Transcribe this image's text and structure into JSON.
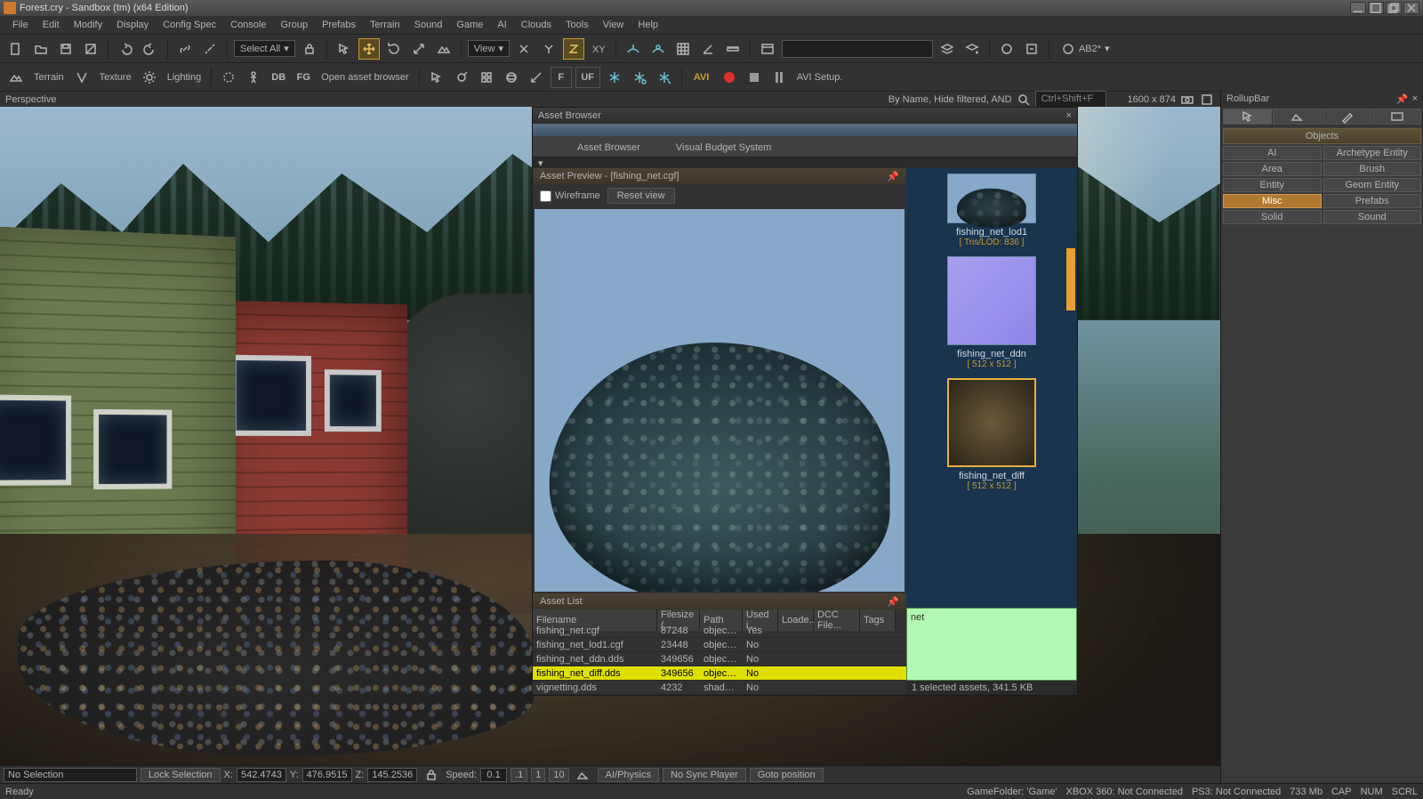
{
  "window": {
    "title": "Forest.cry - Sandbox (tm) (x64 Edition)"
  },
  "menu": [
    "File",
    "Edit",
    "Modify",
    "Display",
    "Config Spec",
    "Console",
    "Group",
    "Prefabs",
    "Terrain",
    "Sound",
    "Game",
    "AI",
    "Clouds",
    "Tools",
    "View",
    "Help"
  ],
  "toolbar1": {
    "select_all": "Select All",
    "view": "View",
    "ab2": "AB2*"
  },
  "toolbar2": {
    "terrain": "Terrain",
    "texture": "Texture",
    "lighting": "Lighting",
    "db": "DB",
    "fg": "FG",
    "open_asset_browser": "Open asset browser",
    "f": "F",
    "uf": "UF",
    "avi": "AVI",
    "avi_setup": "AVI Setup."
  },
  "viewport": {
    "label": "Perspective",
    "search_label": "By Name, Hide filtered, AND",
    "search_hint": "Ctrl+Shift+F",
    "resolution": "1600 x 874"
  },
  "asset_browser": {
    "title": "Asset Browser",
    "tabs": [
      "Asset Browser",
      "Visual Budget System"
    ],
    "preview_title_prefix": "Asset Preview - [",
    "preview_file": "fishing_net.cgf",
    "preview_title_suffix": "]",
    "wireframe": "Wireframe",
    "reset_view": "Reset view",
    "asset_list": "Asset List",
    "columns": [
      "Filename",
      "Filesize (...",
      "Path",
      "Used i...",
      "Loade...",
      "DCC File...",
      "Tags"
    ],
    "rows": [
      {
        "name": "fishing_net.cgf",
        "size": "87248",
        "path": "objects/...",
        "used": "Yes",
        "l": "",
        "dcc": "",
        "tags": ""
      },
      {
        "name": "fishing_net_lod1.cgf",
        "size": "23448",
        "path": "objects/...",
        "used": "No",
        "l": "",
        "dcc": "",
        "tags": ""
      },
      {
        "name": "fishing_net_ddn.dds",
        "size": "349656",
        "path": "objects/...",
        "used": "No",
        "l": "",
        "dcc": "",
        "tags": ""
      },
      {
        "name": "fishing_net_diff.dds",
        "size": "349656",
        "path": "objects/...",
        "used": "No",
        "l": "",
        "dcc": "",
        "tags": ""
      },
      {
        "name": "vignetting.dds",
        "size": "4232",
        "path": "shaders/...",
        "used": "No",
        "l": "",
        "dcc": "",
        "tags": ""
      }
    ],
    "selected_row": 3,
    "thumbs": [
      {
        "name": "fishing_net_lod1",
        "meta": "[ Tris/LOD: 836 ]",
        "kind": "mesh"
      },
      {
        "name": "fishing_net_ddn",
        "meta": "[ 512 x 512 ]",
        "kind": "normal"
      },
      {
        "name": "fishing_net_diff",
        "meta": "[ 512 x 512 ]",
        "kind": "diff",
        "selected": true
      }
    ],
    "search_value": "net",
    "status": "1 selected assets, 341.5 KB"
  },
  "rollup": {
    "title": "RollupBar",
    "section": "Objects",
    "buttons": [
      "AI",
      "Archetype Entity",
      "Area",
      "Brush",
      "Entity",
      "Geom Entity",
      "Misc",
      "Prefabs",
      "Solid",
      "Sound"
    ],
    "selected": "Misc"
  },
  "viewinfo": {
    "no_selection": "No Selection",
    "lock": "Lock Selection",
    "x_label": "X:",
    "x": "542.4743",
    "y_label": "Y:",
    "y": "476.9515",
    "z_label": "Z:",
    "z": "145.2536",
    "speed_label": "Speed:",
    "speed": "0.1",
    "speed_presets": [
      ".1",
      "1",
      "10"
    ],
    "ai_physics": "AI/Physics",
    "sync": "No Sync Player",
    "goto": "Goto position"
  },
  "status": {
    "ready": "Ready",
    "game_folder": "GameFolder: 'Game'",
    "xbox": "XBOX 360: Not Connected",
    "ps3": "PS3: Not Connected",
    "mem": "733 Mb",
    "caps": "CAP",
    "num": "NUM",
    "scrl": "SCRL"
  }
}
